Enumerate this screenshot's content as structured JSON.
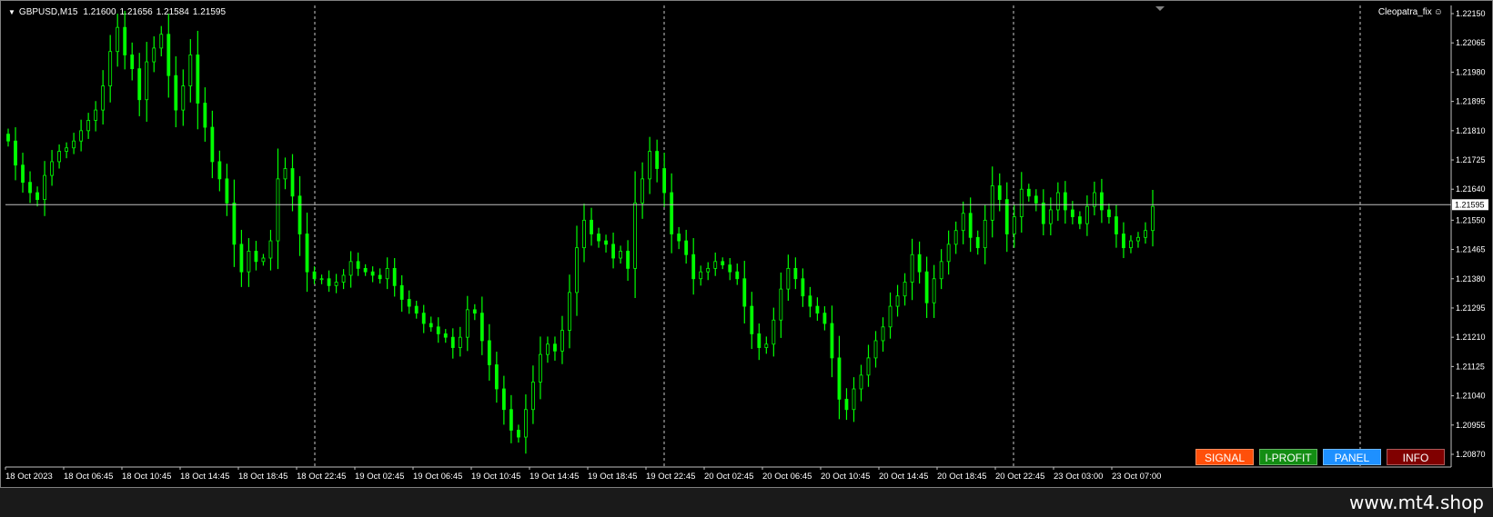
{
  "header": {
    "symbol": "GBPUSD,M15",
    "open": "1.21600",
    "high": "1.21656",
    "low": "1.21584",
    "close": "1.21595"
  },
  "ea_name": "Cleopatra_fix",
  "buttons": [
    {
      "label": "SIGNAL",
      "color": "#ff4f0a"
    },
    {
      "label": "I-PROFIT",
      "color": "#138d13"
    },
    {
      "label": "PANEL",
      "color": "#1e90ff"
    },
    {
      "label": "INFO",
      "color": "#800000"
    }
  ],
  "watermark": "www.mt4.shop",
  "chart_data": {
    "type": "candlestick",
    "series_color": "#00ff00",
    "y_ticks": [
      "1.22150",
      "1.22065",
      "1.21980",
      "1.21895",
      "1.21810",
      "1.21725",
      "1.21640",
      "1.21550",
      "1.21465",
      "1.21380",
      "1.21295",
      "1.21210",
      "1.21125",
      "1.21040",
      "1.20955",
      "1.20870"
    ],
    "ylim": [
      1.2087,
      1.2215
    ],
    "current_price": "1.21595",
    "x_ticks": [
      "18 Oct 2023",
      "18 Oct 06:45",
      "18 Oct 10:45",
      "18 Oct 14:45",
      "18 Oct 18:45",
      "18 Oct 22:45",
      "19 Oct 02:45",
      "19 Oct 06:45",
      "19 Oct 10:45",
      "19 Oct 14:45",
      "19 Oct 18:45",
      "19 Oct 22:45",
      "20 Oct 02:45",
      "20 Oct 06:45",
      "20 Oct 10:45",
      "20 Oct 14:45",
      "20 Oct 18:45",
      "20 Oct 22:45",
      "23 Oct 03:00",
      "23 Oct 07:00"
    ],
    "grid": false,
    "day_separators": true,
    "closes": [
      1.2178,
      1.2171,
      1.2166,
      1.2163,
      1.2161,
      1.2168,
      1.2172,
      1.2175,
      1.2176,
      1.2178,
      1.2181,
      1.2184,
      1.2187,
      1.2194,
      1.2204,
      1.2211,
      1.2203,
      1.2199,
      1.219,
      1.2201,
      1.2205,
      1.2209,
      1.2197,
      1.2187,
      1.2194,
      1.2203,
      1.2189,
      1.2182,
      1.2172,
      1.2167,
      1.216,
      1.2148,
      1.214,
      1.2146,
      1.2143,
      1.2144,
      1.2149,
      1.2167,
      1.217,
      1.2162,
      1.2151,
      1.214,
      1.2138,
      1.2138,
      1.2136,
      1.2137,
      1.2139,
      1.2143,
      1.2141,
      1.214,
      1.2139,
      1.2138,
      1.2141,
      1.2136,
      1.2132,
      1.213,
      1.2128,
      1.2125,
      1.2124,
      1.2122,
      1.2121,
      1.2118,
      1.2121,
      1.2129,
      1.2128,
      1.212,
      1.2113,
      1.2106,
      1.21,
      1.2094,
      1.2092,
      1.21,
      1.2108,
      1.2116,
      1.2119,
      1.2117,
      1.2123,
      1.2134,
      1.2147,
      1.2155,
      1.2151,
      1.2149,
      1.2148,
      1.2144,
      1.2146,
      1.2141,
      1.216,
      1.2167,
      1.2175,
      1.217,
      1.2163,
      1.2151,
      1.2149,
      1.2145,
      1.2138,
      1.214,
      1.2141,
      1.2143,
      1.2142,
      1.214,
      1.2138,
      1.213,
      1.2122,
      1.2118,
      1.2119,
      1.2126,
      1.2135,
      1.2141,
      1.2138,
      1.2133,
      1.213,
      1.2128,
      1.2125,
      1.2115,
      1.2103,
      1.21,
      1.2106,
      1.211,
      1.2115,
      1.212,
      1.2124,
      1.213,
      1.2133,
      1.2137,
      1.2145,
      1.214,
      1.2131,
      1.2138,
      1.2143,
      1.2148,
      1.2152,
      1.2157,
      1.215,
      1.2147,
      1.2155,
      1.2165,
      1.2161,
      1.2151,
      1.2156,
      1.2164,
      1.2162,
      1.216,
      1.2154,
      1.2158,
      1.2163,
      1.2158,
      1.2156,
      1.2154,
      1.2159,
      1.2163,
      1.2158,
      1.2156,
      1.2151,
      1.2147,
      1.2149,
      1.215,
      1.2152,
      1.2159
    ]
  }
}
